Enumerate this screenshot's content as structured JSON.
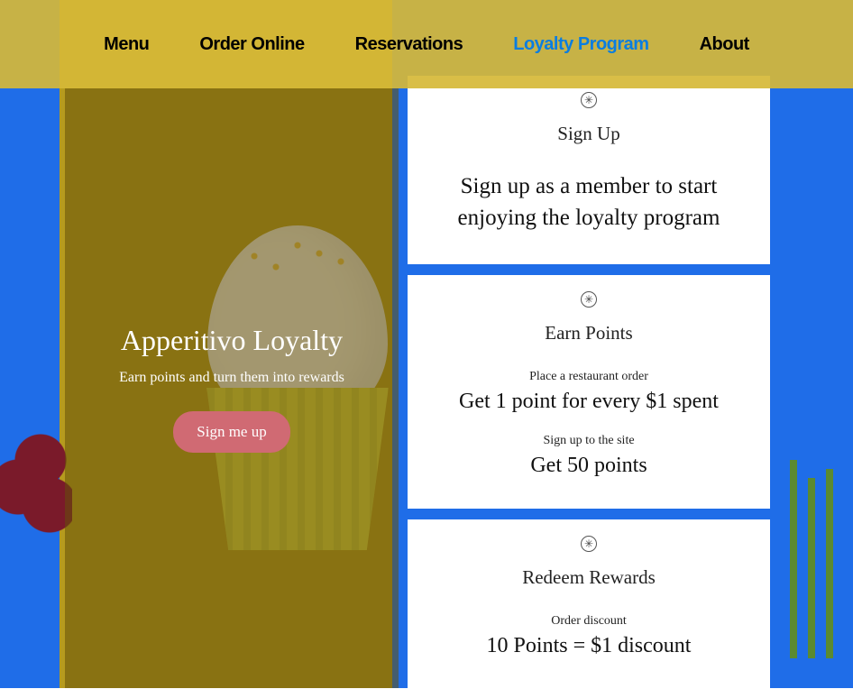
{
  "nav": {
    "items": [
      {
        "label": "Menu",
        "active": false
      },
      {
        "label": "Order Online",
        "active": false
      },
      {
        "label": "Reservations",
        "active": false
      },
      {
        "label": "Loyalty Program",
        "active": true
      },
      {
        "label": "About",
        "active": false
      }
    ]
  },
  "hero": {
    "title": "Apperitivo Loyalty",
    "subtitle": "Earn points and turn them into rewards",
    "cta": "Sign me up"
  },
  "cards": {
    "signup": {
      "title": "Sign Up",
      "desc": "Sign up as a member to start enjoying the loyalty program"
    },
    "earn": {
      "title": "Earn Points",
      "rules": [
        {
          "label": "Place a restaurant order",
          "value": "Get 1 point for every $1 spent"
        },
        {
          "label": "Sign up to the site",
          "value": "Get 50 points"
        }
      ]
    },
    "redeem": {
      "title": "Redeem Rewards",
      "rules": [
        {
          "label": "Order discount",
          "value": "10 Points = $1 discount"
        }
      ]
    }
  }
}
